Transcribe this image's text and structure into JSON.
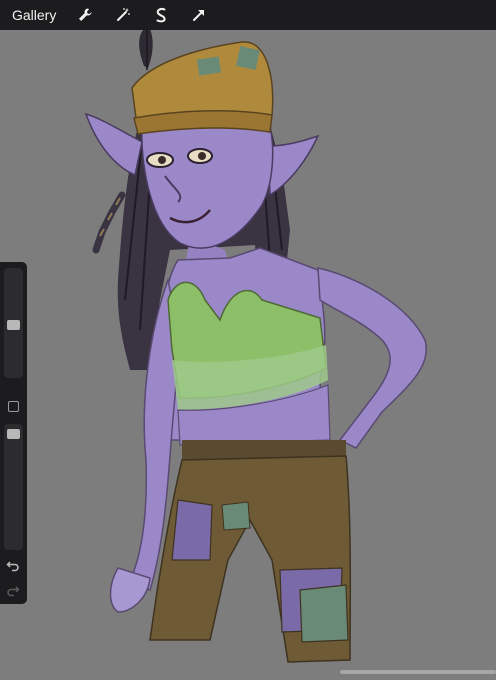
{
  "toolbar": {
    "gallery_label": "Gallery",
    "tools": [
      "wrench-icon",
      "magic-wand-icon",
      "selection-icon",
      "transform-arrow-icon"
    ]
  },
  "sidebar": {
    "brush_size": 0.48,
    "opacity": 0.96
  },
  "colors": {
    "toolbar_bg": "#1c1c1e",
    "canvas_bg": "#7d7d7d",
    "skin": "#9a88c9",
    "hat": "#b08a3c",
    "top": "#8dbf68",
    "pants": "#6e5b35"
  }
}
